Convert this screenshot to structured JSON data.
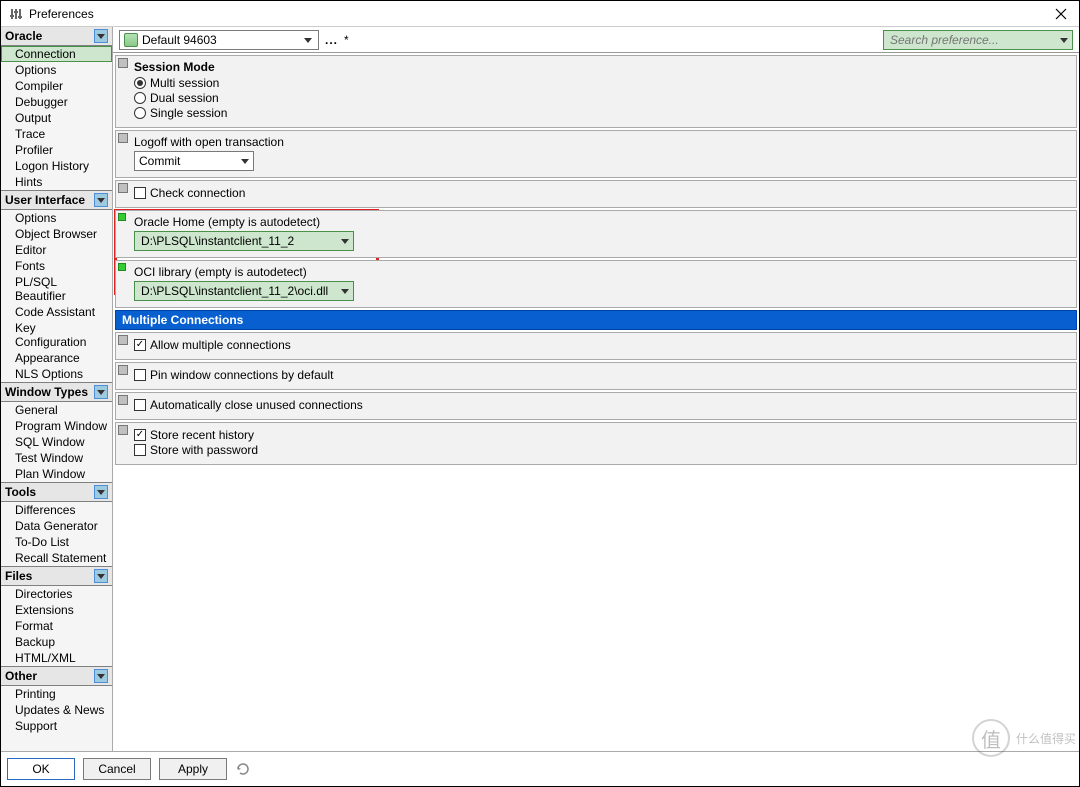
{
  "window": {
    "title": "Preferences"
  },
  "sidebar": {
    "categories": [
      {
        "name": "Oracle",
        "items": [
          "Connection",
          "Options",
          "Compiler",
          "Debugger",
          "Output",
          "Trace",
          "Profiler",
          "Logon History",
          "Hints"
        ],
        "selected": 0
      },
      {
        "name": "User Interface",
        "items": [
          "Options",
          "Object Browser",
          "Editor",
          "Fonts",
          "PL/SQL Beautifier",
          "Code Assistant",
          "Key Configuration",
          "Appearance",
          "NLS Options"
        ]
      },
      {
        "name": "Window Types",
        "items": [
          "General",
          "Program Window",
          "SQL Window",
          "Test Window",
          "Plan Window"
        ]
      },
      {
        "name": "Tools",
        "items": [
          "Differences",
          "Data Generator",
          "To-Do List",
          "Recall Statement"
        ]
      },
      {
        "name": "Files",
        "items": [
          "Directories",
          "Extensions",
          "Format",
          "Backup",
          "HTML/XML"
        ]
      },
      {
        "name": "Other",
        "items": [
          "Printing",
          "Updates & News",
          "Support"
        ]
      }
    ]
  },
  "toolbar": {
    "db_label": "Default 94603",
    "dots": "...",
    "modified": "*",
    "search_placeholder": "Search preference..."
  },
  "settings": {
    "session_mode": {
      "title": "Session Mode",
      "options": [
        "Multi session",
        "Dual session",
        "Single session"
      ],
      "selected": 0
    },
    "logoff": {
      "label": "Logoff with open transaction",
      "value": "Commit"
    },
    "check_connection": {
      "label": "Check connection",
      "checked": false
    },
    "oracle_home": {
      "label": "Oracle Home (empty is autodetect)",
      "value": "D:\\PLSQL\\instantclient_11_2"
    },
    "oci_library": {
      "label": "OCI library (empty is autodetect)",
      "value": "D:\\PLSQL\\instantclient_11_2\\oci.dll"
    },
    "multiple_connections": {
      "header": "Multiple Connections",
      "allow": {
        "label": "Allow multiple connections",
        "checked": true
      },
      "pin": {
        "label": "Pin window connections by default",
        "checked": false
      },
      "autoclose": {
        "label": "Automatically close unused connections",
        "checked": false
      },
      "store_recent": {
        "label": "Store recent history",
        "checked": true
      },
      "store_pw": {
        "label": "Store with password",
        "checked": false
      }
    }
  },
  "buttons": {
    "ok": "OK",
    "cancel": "Cancel",
    "apply": "Apply"
  },
  "watermark": "什么值得买"
}
